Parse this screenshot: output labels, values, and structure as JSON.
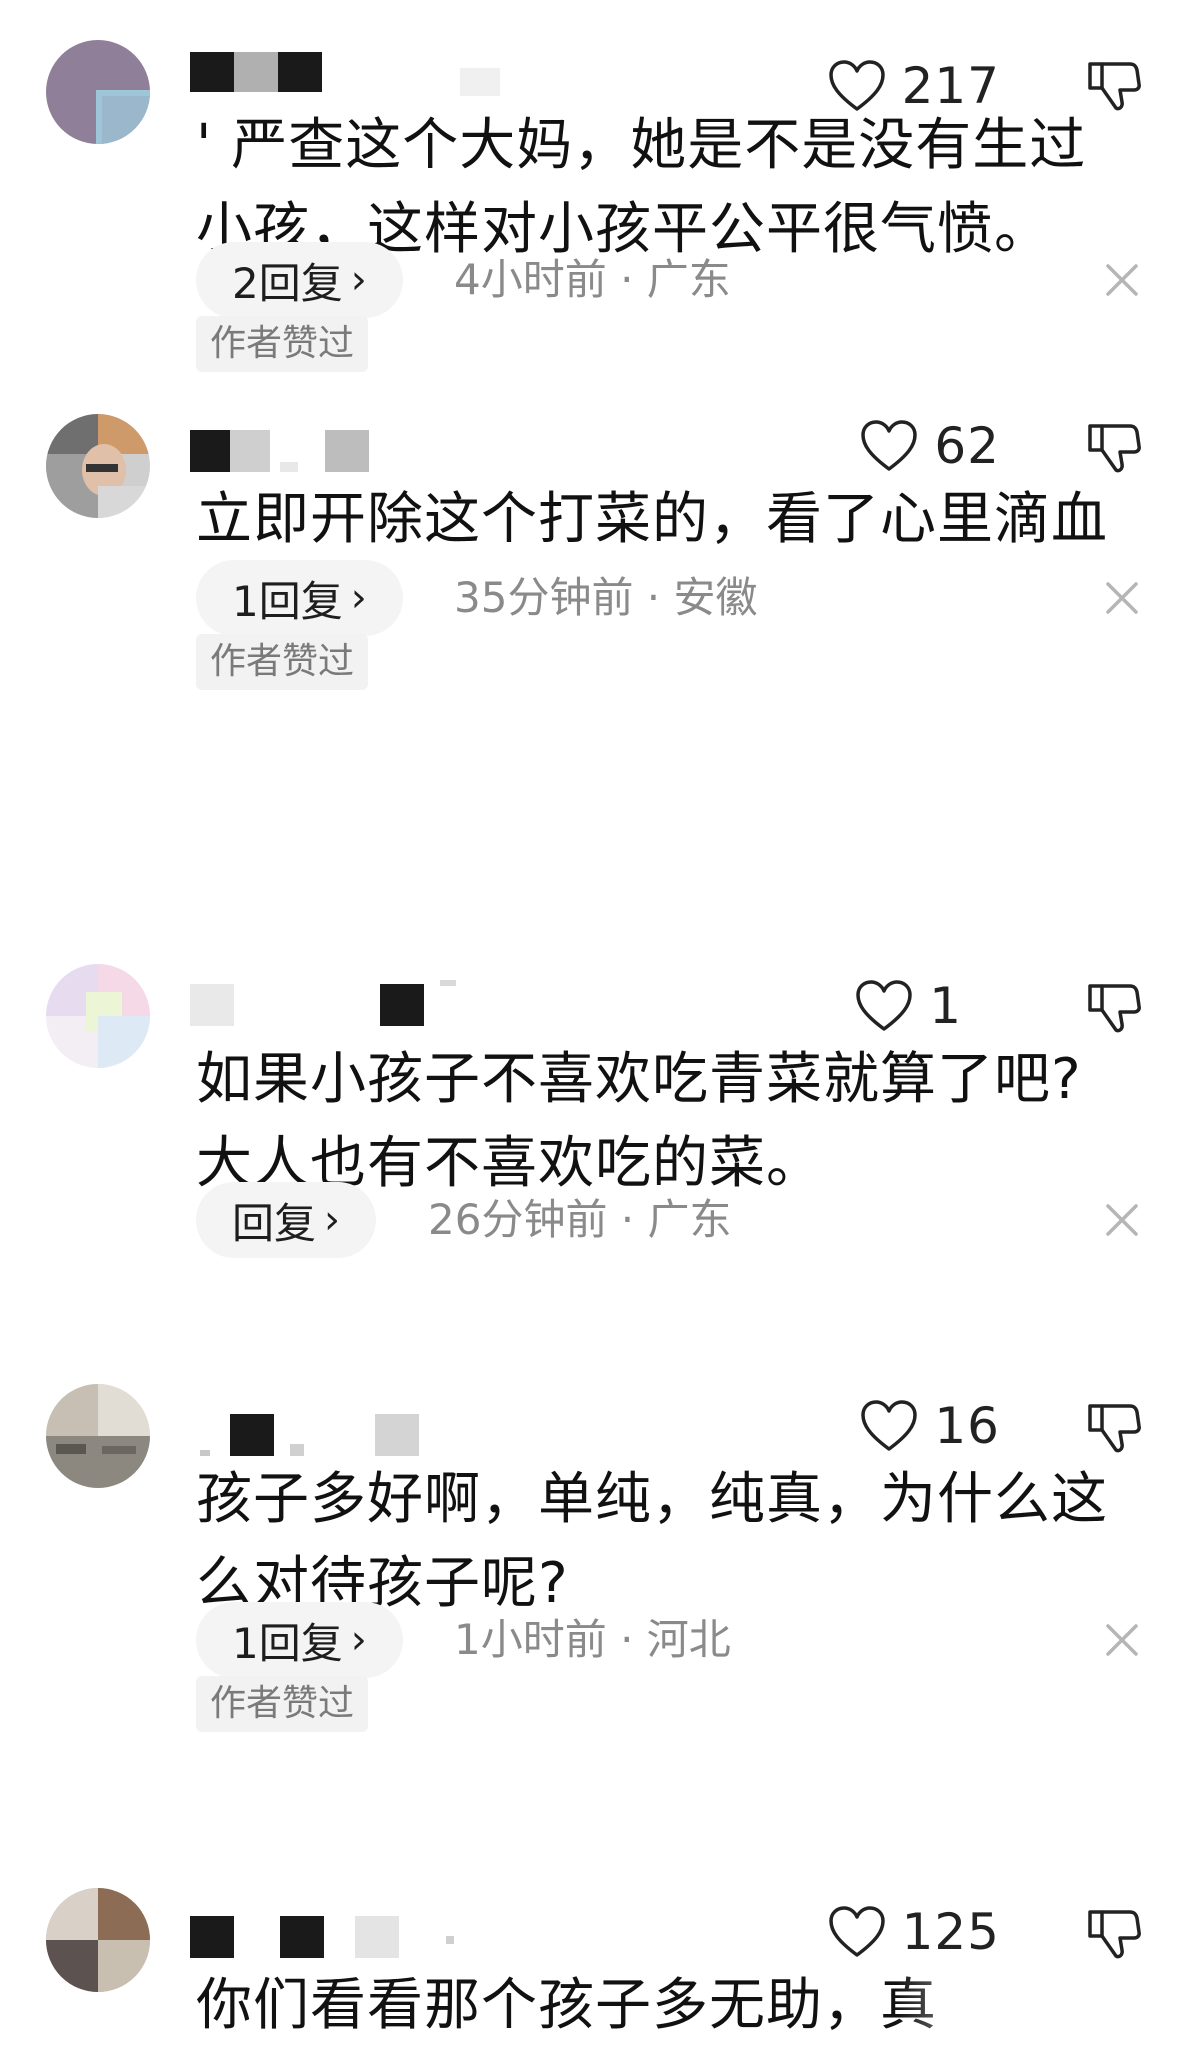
{
  "comments": [
    {
      "likes": "217",
      "text": "' 严查这个大妈，她是不是没有生过小孩，这样对小孩平公平很气愤。",
      "reply": "2回复",
      "meta": "4小时前 · 广东",
      "author_liked": "作者赞过"
    },
    {
      "likes": "62",
      "text": "立即开除这个打菜的，看了心里滴血",
      "reply": "1回复",
      "meta": "35分钟前 · 安徽",
      "author_liked": "作者赞过"
    },
    {
      "likes": "1",
      "text": "如果小孩子不喜欢吃青菜就算了吧?大人也有不喜欢吃的菜。",
      "reply": "回复",
      "meta": "26分钟前 · 广东"
    },
    {
      "likes": "16",
      "text": "孩子多好啊，单纯，纯真，为什么这么对待孩子呢?",
      "reply": "1回复",
      "meta": "1小时前 · 河北",
      "author_liked": "作者赞过"
    },
    {
      "likes": "125",
      "text": "你们看看那个孩子多无助，真"
    }
  ],
  "reply_chevron": "›",
  "icons": {
    "like": "heart-outline-icon",
    "dislike": "thumbs-down-outline-icon",
    "close": "close-icon"
  },
  "colors": {
    "text": "#111111",
    "meta": "#8a8a8a",
    "pill_bg": "#f4f4f4"
  }
}
